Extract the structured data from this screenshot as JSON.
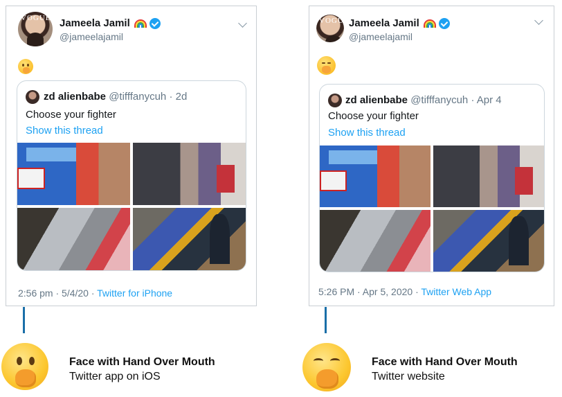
{
  "left_tweet": {
    "author_name": "Jameela Jamil",
    "author_handle": "@jameelajamil",
    "avatar_masthead": "VOGUE",
    "emoji": "face-with-hand-over-mouth-ios",
    "quote": {
      "name": "zd alienbabe",
      "handle": "@tifffanycuh",
      "time": "· 2d",
      "text": "Choose your fighter",
      "link": "Show this thread"
    },
    "timestamp": "2:56 pm · 5/4/20 ·",
    "source": "Twitter for iPhone"
  },
  "right_tweet": {
    "author_name": "Jameela Jamil",
    "author_handle": "@jameelajamil",
    "avatar_masthead": "VOGUE",
    "emoji": "face-with-hand-over-mouth-web",
    "quote": {
      "name": "zd alienbabe",
      "handle": "@tifffanycuh",
      "time": "· Apr 4",
      "text": "Choose your fighter",
      "link": "Show this thread"
    },
    "timestamp": "5:26 PM · Apr 5, 2020 ·",
    "source": "Twitter Web App"
  },
  "captions": {
    "left": {
      "title": "Face with Hand Over Mouth",
      "subtitle": "Twitter app on iOS"
    },
    "right": {
      "title": "Face with Hand Over Mouth",
      "subtitle": "Twitter website"
    }
  },
  "colors": {
    "link": "#1da1f2",
    "verified": "#1da1f2",
    "connector": "#1a6fa8",
    "muted": "#657786"
  }
}
